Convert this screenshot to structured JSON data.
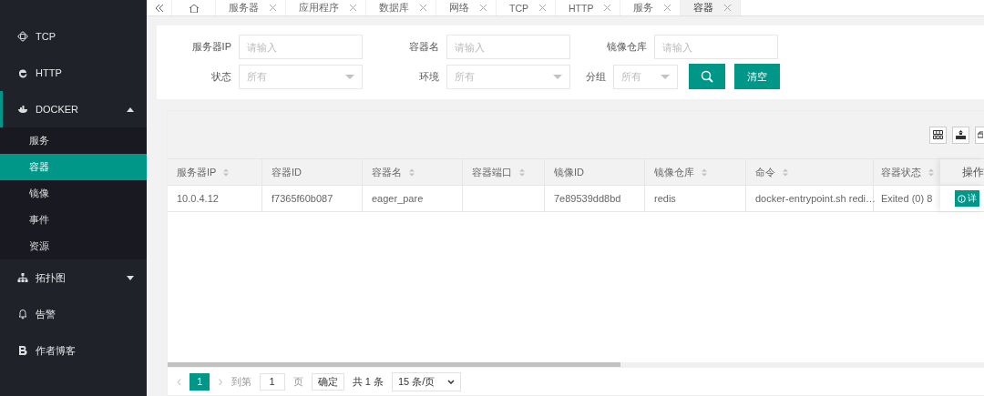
{
  "sidebar": {
    "items": [
      {
        "label": "TCP",
        "expanded": false,
        "caret": false
      },
      {
        "label": "HTTP",
        "expanded": false,
        "caret": false
      },
      {
        "label": "DOCKER",
        "expanded": true,
        "caret": true,
        "children": [
          {
            "label": "服务",
            "selected": false
          },
          {
            "label": "容器",
            "selected": true
          },
          {
            "label": "镜像",
            "selected": false
          },
          {
            "label": "事件",
            "selected": false
          },
          {
            "label": "资源",
            "selected": false
          }
        ]
      },
      {
        "label": "拓扑图",
        "expanded": false,
        "caret": true
      },
      {
        "label": "告警",
        "expanded": false,
        "caret": false
      },
      {
        "label": "作者博客",
        "expanded": false,
        "caret": false
      }
    ]
  },
  "tabs": [
    {
      "label": "服务器",
      "selected": false
    },
    {
      "label": "应用程序",
      "selected": false
    },
    {
      "label": "数据库",
      "selected": false
    },
    {
      "label": "网络",
      "selected": false
    },
    {
      "label": "TCP",
      "selected": false
    },
    {
      "label": "HTTP",
      "selected": false
    },
    {
      "label": "服务",
      "selected": false
    },
    {
      "label": "容器",
      "selected": true
    }
  ],
  "filters": [
    {
      "label": "服务器IP",
      "kind": "input",
      "placeholder": "请输入"
    },
    {
      "label": "容器名",
      "kind": "input",
      "placeholder": "请输入"
    },
    {
      "label": "镜像仓库",
      "kind": "input",
      "placeholder": "请输入"
    },
    {
      "label": "状态",
      "kind": "select",
      "placeholder": "所有"
    },
    {
      "label": "环境",
      "kind": "select",
      "placeholder": "所有"
    },
    {
      "label": "分组",
      "kind": "select",
      "placeholder": "所有"
    }
  ],
  "clear_button": "清空",
  "table": {
    "columns": [
      {
        "label": "服务器IP",
        "sortable": true
      },
      {
        "label": "容器ID",
        "sortable": false
      },
      {
        "label": "容器名",
        "sortable": true
      },
      {
        "label": "容器端口",
        "sortable": true
      },
      {
        "label": "镜像ID",
        "sortable": false
      },
      {
        "label": "镜像仓库",
        "sortable": true
      },
      {
        "label": "命令",
        "sortable": true
      },
      {
        "label": "容器状态",
        "sortable": true
      }
    ],
    "action_column": "操作",
    "rows": [
      {
        "cells": [
          "10.0.4.12",
          "f7365f60b087",
          "eager_pare",
          "",
          "7e89539dd8bd",
          "redis",
          "docker-entrypoint.sh redi…",
          "Exited (0) 8"
        ],
        "action": "详"
      }
    ]
  },
  "pagination": {
    "prev": "‹",
    "pages": [
      {
        "label": "1",
        "selected": true
      }
    ],
    "next": "›",
    "goto_label": "到第",
    "goto_value": "1",
    "page_unit": "页",
    "confirm": "确定",
    "total": "共 1 条",
    "page_size": "15 条/页"
  }
}
